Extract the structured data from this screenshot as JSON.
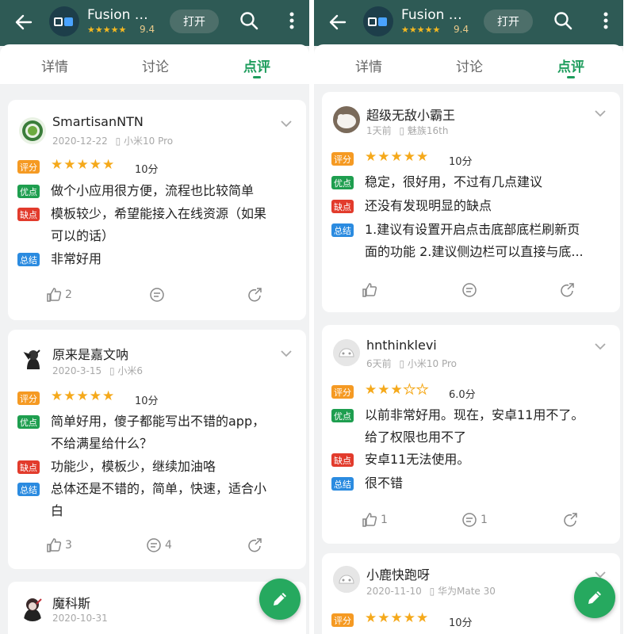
{
  "app": {
    "name": "Fusion A…",
    "stars": "★★★★★",
    "rating": "9.4",
    "open_label": "打开"
  },
  "tabs": [
    "详情",
    "讨论",
    "点评"
  ],
  "colors": {
    "header": "#2e5a55",
    "accent": "#1d9c5c",
    "score_tag": "#f59a23",
    "pro_tag": "#1e9e4f",
    "con_tag": "#e23b2c",
    "sum_tag": "#2b8be0",
    "star": "#f5a91b"
  },
  "tags": {
    "score": "评分",
    "pro": "优点",
    "con": "缺点",
    "summary": "总结"
  },
  "left_reviews": [
    {
      "user": "SmartisanNTN",
      "date": "2020-12-22",
      "device": "小米10 Pro",
      "rating": 5,
      "score": "10分",
      "pro": [
        "做个小应用很方便，流程也比较简单"
      ],
      "con": [
        "模板较少，希望能接入在线资源（如果",
        "可以的话）"
      ],
      "summary": [
        "非常好用"
      ],
      "likes": "2",
      "comments": ""
    },
    {
      "user": "原来是嘉文呐",
      "date": "2020-3-15",
      "device": "小米6",
      "rating": 5,
      "score": "10分",
      "pro": [
        "简单好用，傻子都能写出不错的app，",
        "不给满星给什么？"
      ],
      "con": [
        "功能少，模板少，继续加油咯"
      ],
      "summary": [
        "总体还是不错的，简单，快速，适合小",
        "白"
      ],
      "likes": "3",
      "comments": "4"
    },
    {
      "user": "魔科斯",
      "date": "2020-10-31"
    }
  ],
  "right_reviews": [
    {
      "user": "超级无敌小霸王",
      "date": "1天前",
      "device": "魅族16th",
      "rating": 5,
      "score": "10分",
      "pro": [
        "稳定，很好用，不过有几点建议"
      ],
      "con": [
        "还没有发现明显的缺点"
      ],
      "summary": [
        "1.建议有设置开启点击底部底栏刷新页",
        "面的功能 2.建议侧边栏可以直接与底..."
      ],
      "likes": "",
      "comments": ""
    },
    {
      "user": "hnthinklevi",
      "date": "6天前",
      "device": "小米10 Pro",
      "rating": 3,
      "score": "6.0分",
      "pro": [
        "以前非常好用。现在，安卓11用不了。",
        "给了权限也用不了"
      ],
      "con": [
        "安卓11无法使用。"
      ],
      "summary": [
        "很不错"
      ],
      "likes": "1",
      "comments": "1"
    },
    {
      "user": "小鹿快跑呀",
      "date": "2020-11-10",
      "device": "华为Mate 30",
      "rating": 5,
      "score": "10分"
    }
  ]
}
